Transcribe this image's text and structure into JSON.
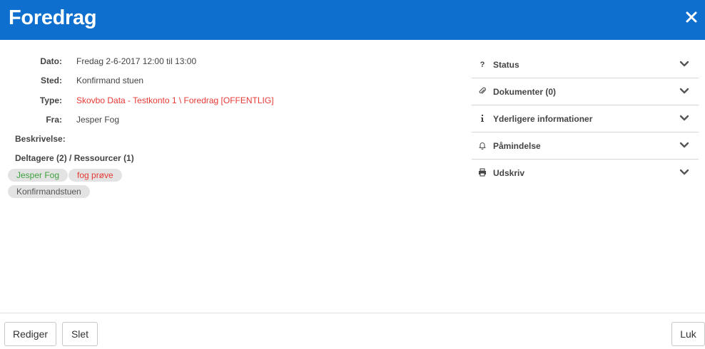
{
  "header": {
    "title": "Foredrag",
    "close_icon": "close-icon"
  },
  "details": [
    {
      "label": "Dato:",
      "value": "Fredag 2-6-2017 12:00 til 13:00"
    },
    {
      "label": "Sted:",
      "value": "Konfirmand stuen"
    },
    {
      "label": "Type:",
      "value": "Skovbo Data - Testkonto 1 \\ Foredrag [OFFENTLIG]"
    },
    {
      "label": "Fra:",
      "value": "Jesper Fog"
    }
  ],
  "description_label": "Beskrivelse:",
  "participants_label": "Deltagere (2) / Ressourcer (1)",
  "chips": {
    "participants": [
      "Jesper Fog",
      "fog prøve"
    ],
    "resources": [
      "Konfirmandstuen"
    ]
  },
  "panel": [
    {
      "label": "Status",
      "icon": "question-icon"
    },
    {
      "label": "Dokumenter (0)",
      "icon": "paperclip-icon"
    },
    {
      "label": "Yderligere informationer",
      "icon": "info-icon"
    },
    {
      "label": "Påmindelse",
      "icon": "bell-icon"
    },
    {
      "label": "Udskriv",
      "icon": "print-icon"
    }
  ],
  "footer": {
    "edit_label": "Rediger",
    "delete_label": "Slet",
    "close_label": "Luk"
  },
  "colors": {
    "header": "#0f6fcf",
    "type_text": "#e53935",
    "chip_green": "#3ea23e",
    "chip_red": "#e53935",
    "chip_bg": "#e3e3e3"
  }
}
